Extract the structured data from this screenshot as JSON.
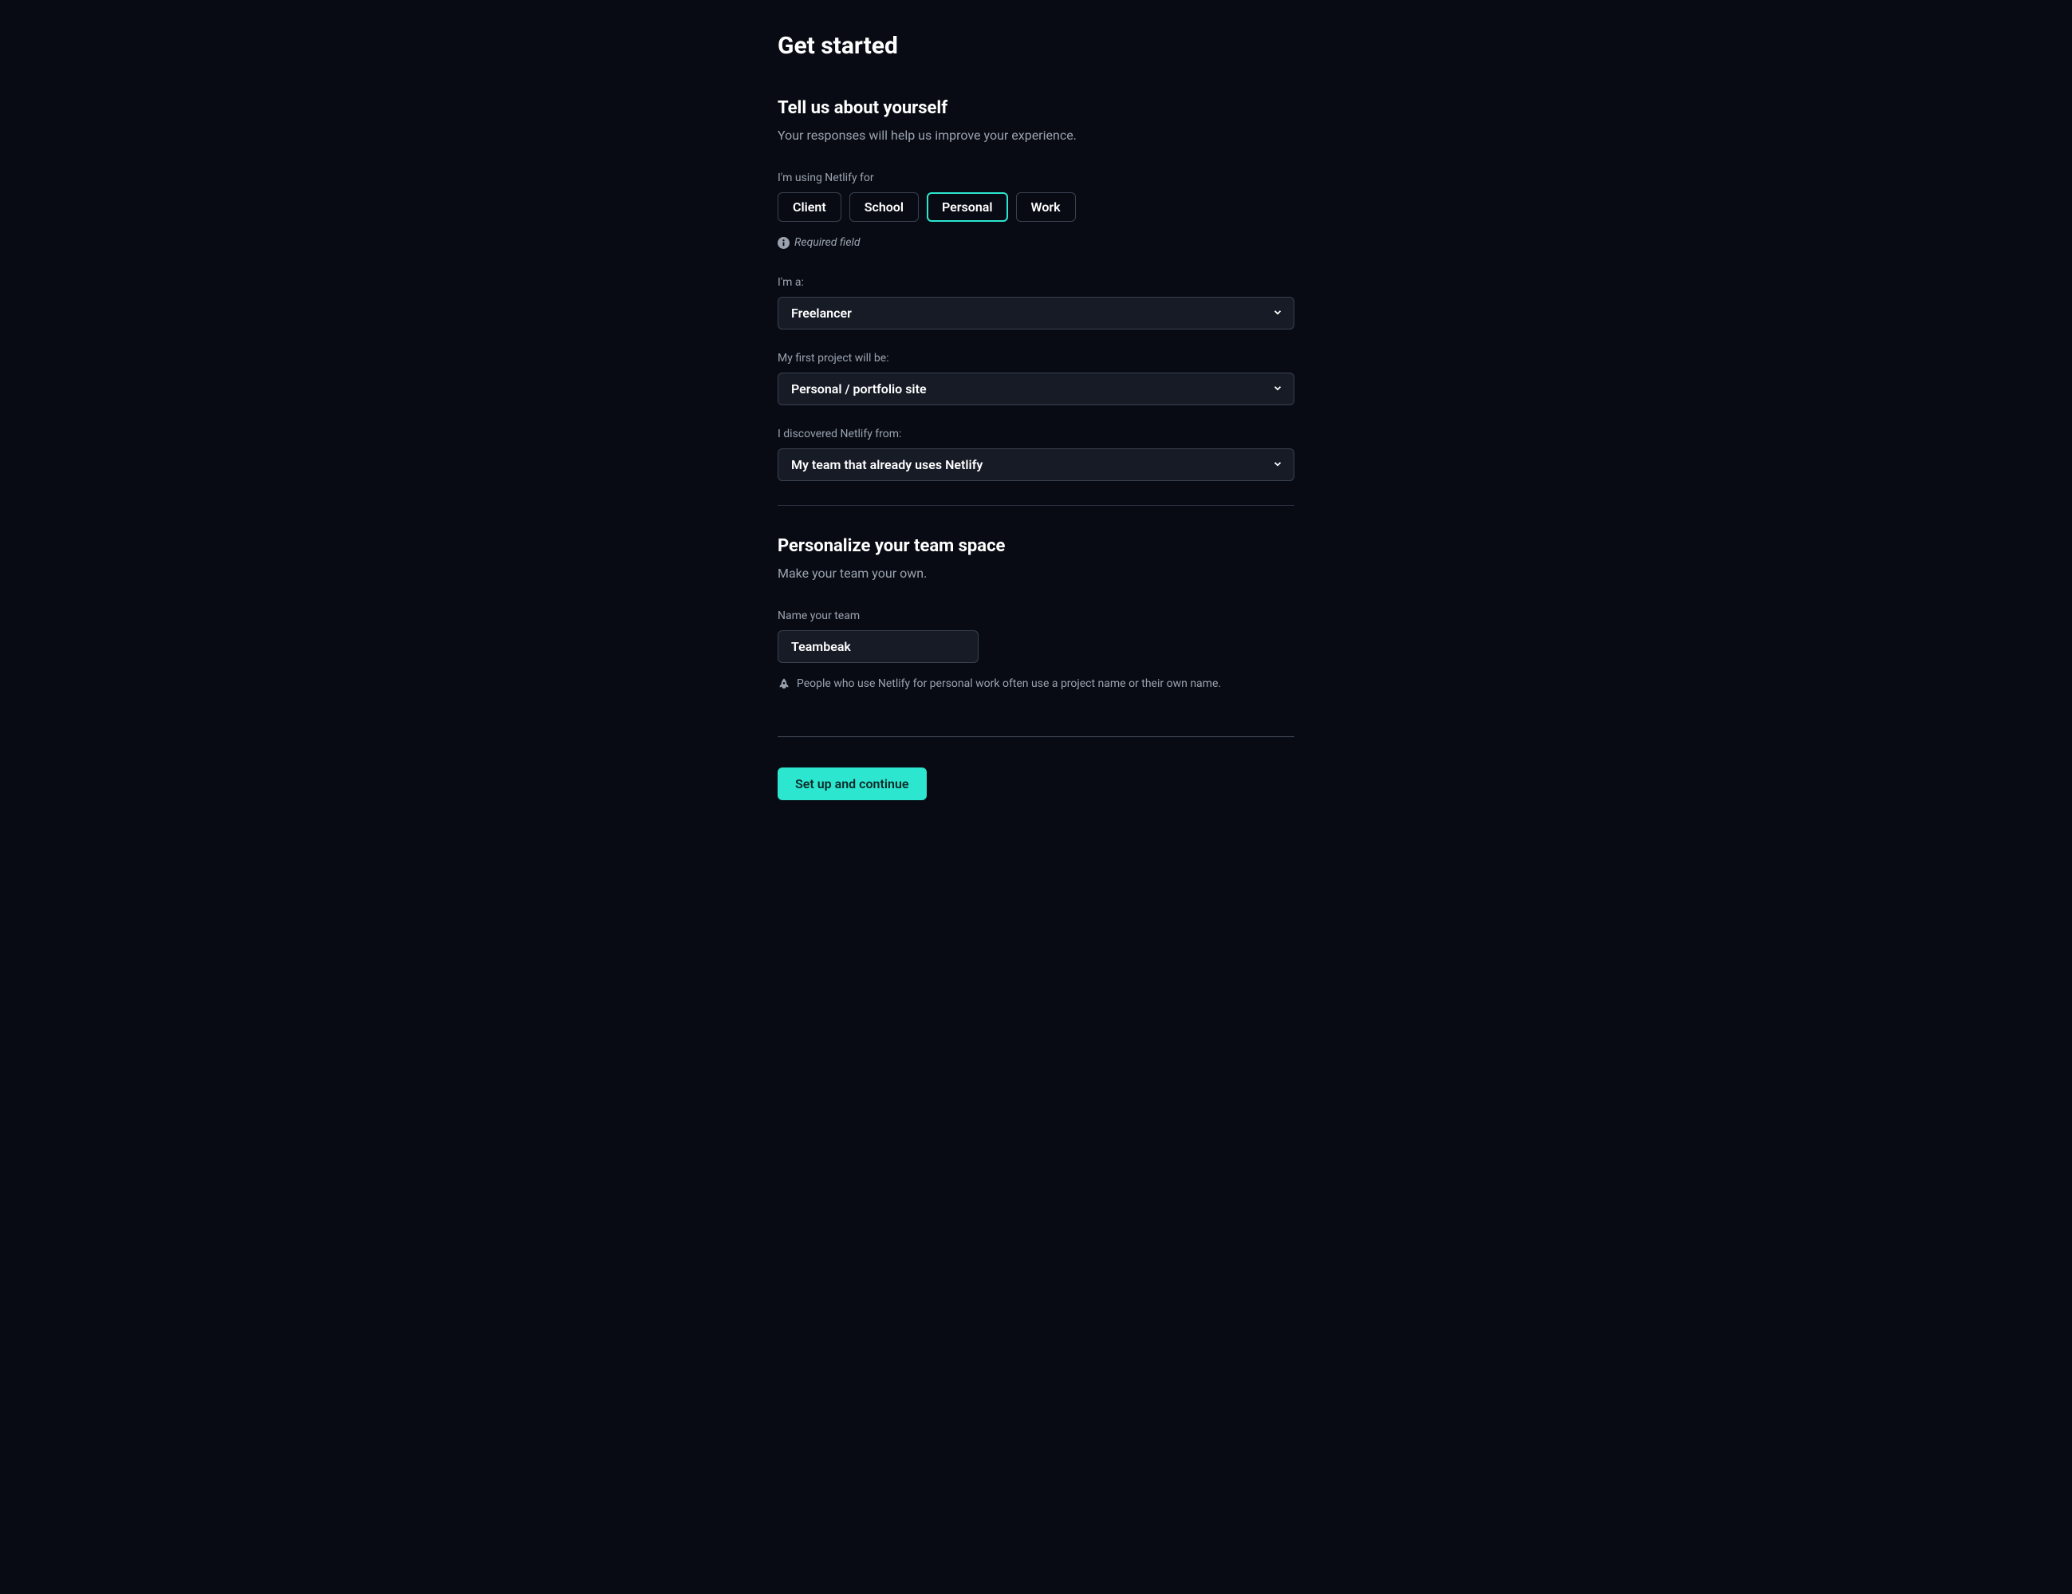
{
  "page_title": "Get started",
  "section1": {
    "title": "Tell us about yourself",
    "subtitle": "Your responses will help us improve your experience."
  },
  "usage": {
    "label": "I'm using Netlify for",
    "options": [
      "Client",
      "School",
      "Personal",
      "Work"
    ],
    "selected": "Personal"
  },
  "required_text": "Required field",
  "role": {
    "label": "I'm a:",
    "value": "Freelancer"
  },
  "project": {
    "label": "My first project will be:",
    "value": "Personal / portfolio site"
  },
  "discovery": {
    "label": "I discovered Netlify from:",
    "value": "My team that already uses Netlify"
  },
  "section2": {
    "title": "Personalize your team space",
    "subtitle": "Make your team your own."
  },
  "team_name": {
    "label": "Name your team",
    "value": "Teambeak",
    "hint": "People who use Netlify for personal work often use a project name or their own name."
  },
  "submit_label": "Set up and continue",
  "colors": {
    "accent": "#2ce6d0",
    "bg": "#080b14",
    "input_bg": "#161b26",
    "border": "#3a4150",
    "muted_text": "#9ba3af"
  }
}
